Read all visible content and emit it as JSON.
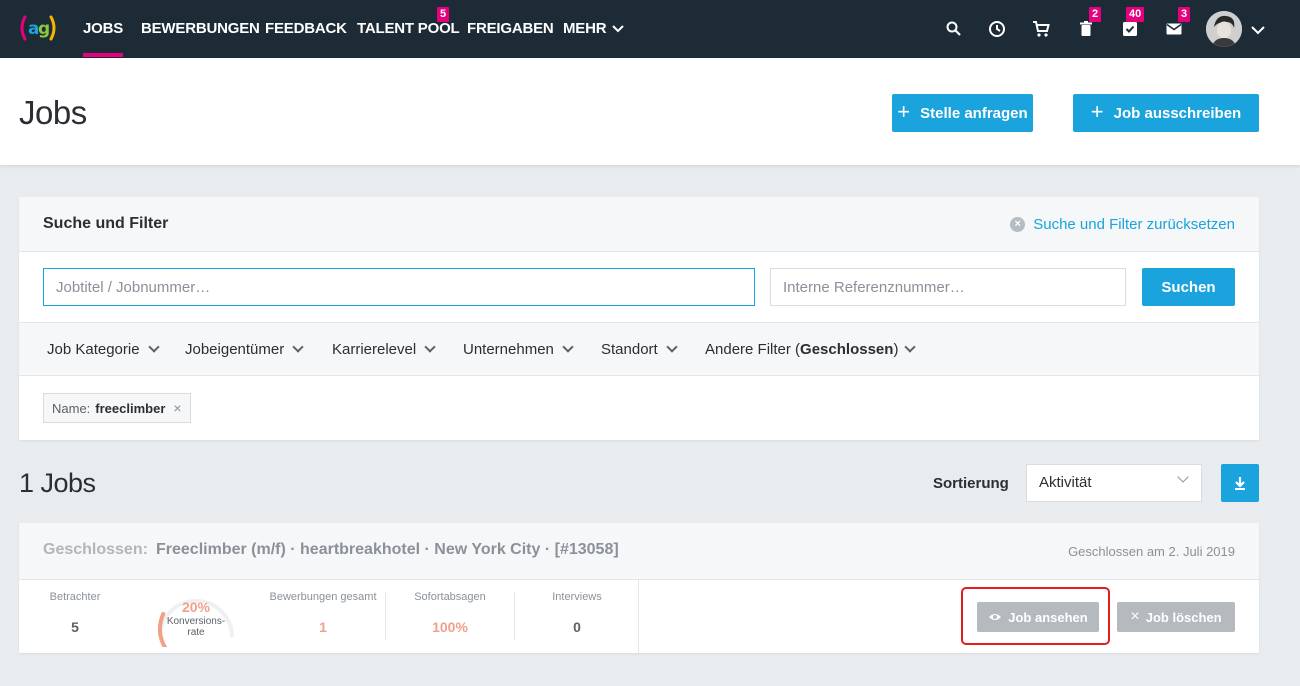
{
  "nav": {
    "items": [
      {
        "label": "JOBS",
        "active": true
      },
      {
        "label": "BEWERBUNGEN"
      },
      {
        "label": "FEEDBACK"
      },
      {
        "label": "TALENT POOL",
        "badge": "5"
      },
      {
        "label": "FREIGABEN"
      },
      {
        "label": "MEHR"
      }
    ],
    "badges": {
      "trash": "2",
      "tasks": "40",
      "mail": "3"
    },
    "icons": [
      "search-icon",
      "clock-icon",
      "cart-icon",
      "trash-icon",
      "checkbox-icon",
      "mail-icon",
      "avatar",
      "chevron-down-icon"
    ],
    "accent": "#e6007e"
  },
  "header": {
    "title": "Jobs",
    "btn_request": "Stelle anfragen",
    "btn_post": "Job ausschreiben",
    "plus": "+"
  },
  "filter": {
    "title": "Suche und Filter",
    "reset": "Suche und Filter zurücksetzen",
    "search_placeholder": "Jobtitel / Jobnummer…",
    "ref_placeholder": "Interne Referenznummer…",
    "search_btn": "Suchen",
    "dropdowns": [
      "Job Kategorie",
      "Jobeigentümer",
      "Karrierelevel",
      "Unternehmen",
      "Standort"
    ],
    "other_prefix": "Andere Filter (",
    "other_value": "Geschlossen",
    "other_suffix": ")",
    "tag_key": "Name:",
    "tag_value": "freeclimber",
    "tag_remove": "×"
  },
  "results": {
    "count": "1 Jobs",
    "sort_label": "Sortierung",
    "sort_value": "Aktivität"
  },
  "job": {
    "status": "Geschlossen:",
    "title": "Freeclimber (m/f) · heartbreakhotel · New York City · [#13058]",
    "closed_date": "Geschlossen am 2. Juli 2019",
    "stats": {
      "viewers_label": "Betrachter",
      "viewers": "5",
      "conversion": "20%",
      "conversion_label": "Konversions-",
      "conversion_label2": "rate",
      "conversion_fraction": 0.2,
      "applications_label": "Bewerbungen gesamt",
      "applications": "1",
      "rejections_label": "Sofortabsagen",
      "rejections": "100%",
      "interviews_label": "Interviews",
      "interviews": "0"
    },
    "btn_view": "Job ansehen",
    "btn_delete": "Job löschen"
  }
}
